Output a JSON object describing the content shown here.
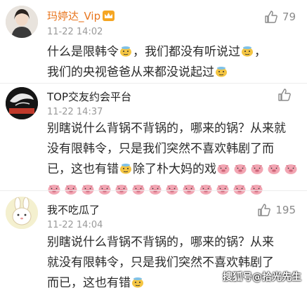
{
  "comments": [
    {
      "username": "玛婷达_Vip",
      "time": "11-22 14:02",
      "likes": "79",
      "lines": [
        "什么是限韩令",
        "，我们都没有听说过",
        "，",
        "我们的央视爸爸从来都没说起过"
      ]
    },
    {
      "username": "TOP交友约会平台",
      "time": "11-22 14:37",
      "likes": "",
      "avatar_text": "交友约会平",
      "lines": [
        "别瞎说什么背锅不背锅的，哪来的锅？从来就",
        "没有限韩令，只是我们突然不喜欢韩剧了而",
        "已，这也有错",
        "除了朴大妈的戏"
      ]
    },
    {
      "username": "我不吃瓜了",
      "time": "11-22 14:04",
      "likes": "195",
      "lines": [
        "别瞎说什么背锅不背锅的，哪来的锅？从来",
        "就没有限韩令，只是我们突然不喜欢韩剧了",
        "而已，这也有错"
      ]
    }
  ],
  "watermark": "搜狐号@拾光先生",
  "colors": {
    "username": "#e8761f",
    "time": "#9a9a9a",
    "text": "#2a2a2a",
    "divider": "#ececec"
  },
  "icons": [
    "thumbs-up-icon",
    "doge-emoji-icon",
    "pig-emoji-icon",
    "crown-icon"
  ]
}
